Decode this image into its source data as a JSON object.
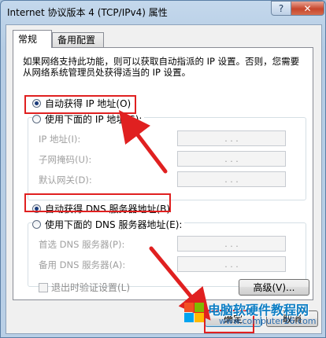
{
  "window": {
    "title": "Internet 协议版本 4 (TCP/IPv4) 属性",
    "help_label": "?",
    "close_label": "✕"
  },
  "tabs": [
    {
      "label": "常规"
    },
    {
      "label": "备用配置"
    }
  ],
  "description": "如果网络支持此功能，则可以获取自动指派的 IP 设置。否则，您需要从网络系统管理员处获得适当的 IP 设置。",
  "ip": {
    "auto_label": "自动获得 IP 地址(O)",
    "manual_label": "使用下面的 IP 地址(S):",
    "fields": [
      {
        "label": "IP 地址(I):",
        "value": ". . ."
      },
      {
        "label": "子网掩码(U):",
        "value": ". . ."
      },
      {
        "label": "默认网关(D):",
        "value": ". . ."
      }
    ]
  },
  "dns": {
    "auto_label": "自动获得 DNS 服务器地址(B)",
    "manual_label": "使用下面的 DNS 服务器地址(E):",
    "fields": [
      {
        "label": "首选 DNS 服务器(P):",
        "value": ". . ."
      },
      {
        "label": "备用 DNS 服务器(A):",
        "value": ". . ."
      }
    ]
  },
  "validate_label": "退出时验证设置(L)",
  "advanced_label": "高级(V)...",
  "ok_label": "确定",
  "cancel_label": "取消",
  "watermark": {
    "text": "电脑软硬件教程网",
    "url": "www.computer26.com"
  },
  "colors": {
    "highlight_box": "#e02020",
    "arrow": "#e02020"
  }
}
